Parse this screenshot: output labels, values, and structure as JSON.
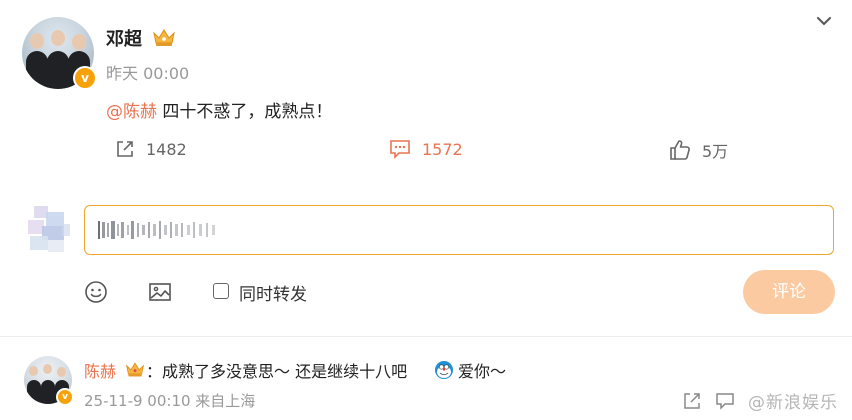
{
  "post": {
    "author": "邓超",
    "time": "昨天 00:00",
    "mention": "@陈赫",
    "text": "四十不惑了，成熟点！",
    "verified_icon": "v",
    "actions": {
      "share": "1482",
      "comment": "1572",
      "like": "5万"
    }
  },
  "compose": {
    "sync_label": "同时转发",
    "submit_label": "评论"
  },
  "reply": {
    "author": "陈赫",
    "text": "：成熟了多没意思～ 还是继续十八吧",
    "text_after_emoji": "爱你～",
    "meta": "25-11-9 00:10 来自上海"
  },
  "watermark": "@新浪娱乐",
  "colors": {
    "accent": "#eb7350",
    "input_border": "#f1a52c",
    "button_bg": "#fccaa0",
    "verified": "#f7a20b",
    "muted": "#999999"
  },
  "icons": [
    "chevron-down-icon",
    "share-icon",
    "comment-icon",
    "like-icon",
    "emoji-icon",
    "image-icon",
    "checkbox",
    "crown-icon",
    "verified-icon"
  ]
}
